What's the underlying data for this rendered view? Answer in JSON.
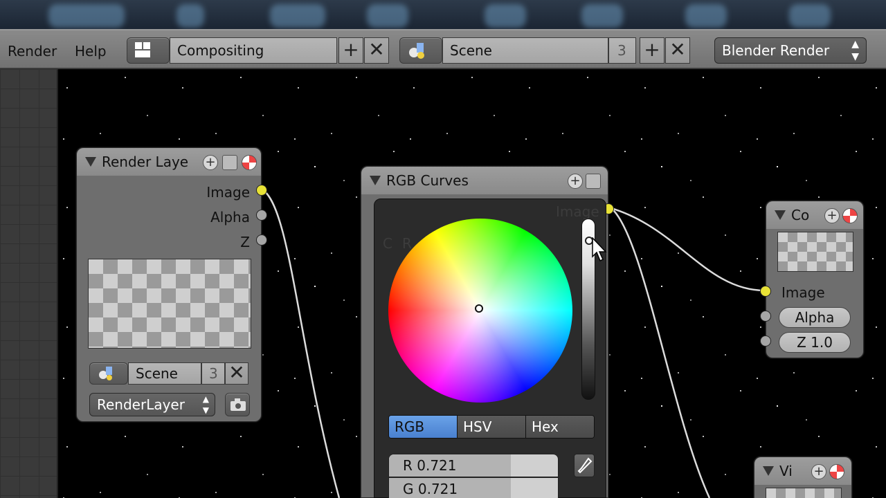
{
  "header": {
    "menus": [
      "Render",
      "Help"
    ],
    "screen_layout": "Compositing",
    "scene": "Scene",
    "scene_users": "3",
    "add_glyph": "+",
    "remove_glyph": "✕",
    "render_engine": "Blender Render"
  },
  "nodes": {
    "render_layers": {
      "title": "Render Laye",
      "outputs": [
        "Image",
        "Alpha",
        "Z"
      ],
      "scene": "Scene",
      "scene_users": "3",
      "layer": "RenderLayer"
    },
    "rgb_curves": {
      "title": "RGB Curves",
      "output_ghost": "Image",
      "ghost_letters": [
        "C",
        "R"
      ]
    },
    "composite": {
      "title": "Co",
      "inputs": [
        "Image",
        "Alpha",
        "Z 1.0"
      ]
    },
    "viewer": {
      "title": "Vi"
    }
  },
  "color_picker": {
    "modes": [
      "RGB",
      "HSV",
      "Hex"
    ],
    "active_mode": "RGB",
    "channels": [
      {
        "label": "R 0.721",
        "value": 0.721
      },
      {
        "label": "G 0.721",
        "value": 0.721
      }
    ]
  },
  "icons": [
    "screen-layout-icon",
    "scene-icon",
    "add-icon",
    "close-icon",
    "eyedropper-icon",
    "camera-icon"
  ],
  "colors": {
    "socket_yellow": "#e8e236",
    "socket_grey": "#a6a6a6",
    "active_mode": "#5a90dc",
    "node_body": "#6e6e6e"
  }
}
